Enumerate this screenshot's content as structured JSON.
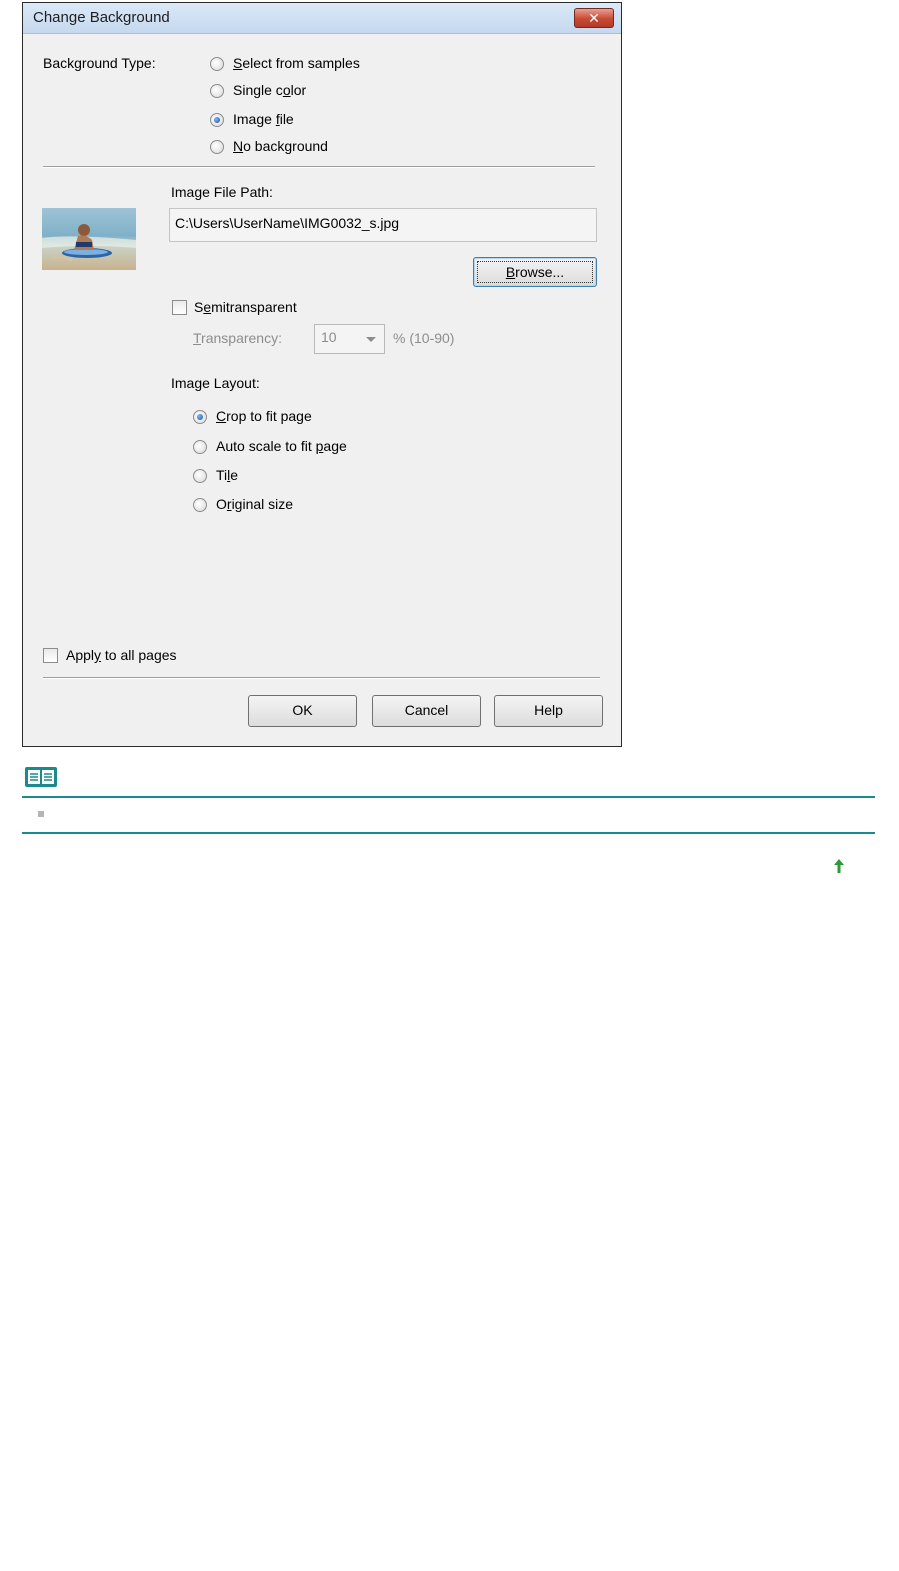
{
  "dialog": {
    "title": "Change Background",
    "close_icon": "✕",
    "background_type": {
      "label": "Background Type:",
      "options": [
        {
          "pre": "",
          "key": "S",
          "post": "elect from samples",
          "checked": false
        },
        {
          "pre": "Single c",
          "key": "o",
          "post": "lor",
          "checked": false
        },
        {
          "pre": "Image ",
          "key": "f",
          "post": "ile",
          "checked": true
        },
        {
          "pre": "",
          "key": "N",
          "post": "o background",
          "checked": false
        }
      ]
    },
    "image_file_path": {
      "label": "Image File Path:",
      "value": "C:\\Users\\UserName\\IMG0032_s.jpg"
    },
    "browse": {
      "key": "B",
      "post": "rowse..."
    },
    "semitransparent": {
      "pre": "S",
      "key": "e",
      "post": "mitransparent",
      "checked": false
    },
    "transparency": {
      "key": "T",
      "post": "ransparency:",
      "value": "10",
      "range": "% (10-90)"
    },
    "image_layout": {
      "label": "Image Layout:",
      "options": [
        {
          "pre": "",
          "key": "C",
          "post": "rop to fit page",
          "checked": true
        },
        {
          "pre": "Auto scale to fit ",
          "key": "p",
          "post": "age",
          "checked": false
        },
        {
          "pre": "Ti",
          "key": "l",
          "post": "e",
          "checked": false
        },
        {
          "pre": "O",
          "key": "r",
          "post": "iginal size",
          "checked": false
        }
      ]
    },
    "apply_all": {
      "pre": "Appl",
      "key": "y",
      "post": " to all pages",
      "checked": false
    },
    "buttons": {
      "ok": "OK",
      "cancel": "Cancel",
      "help": "Help"
    }
  },
  "note": {
    "icon": "book-note-icon",
    "accent_color": "#1b8a8f"
  },
  "page_top_icon": "up-arrow-icon"
}
